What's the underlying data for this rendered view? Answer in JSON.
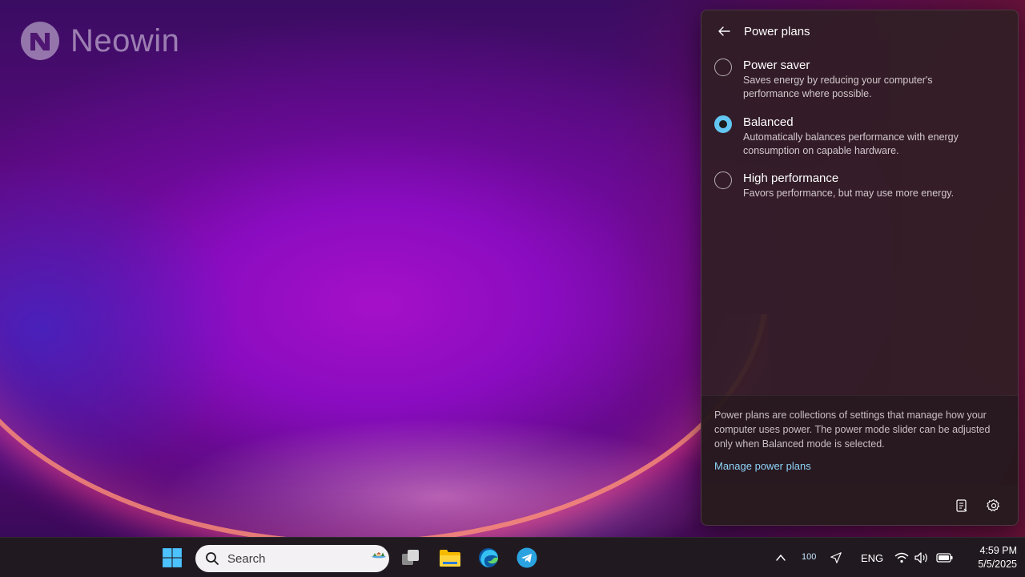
{
  "watermark": {
    "brand": "Neowin"
  },
  "flyout": {
    "title": "Power plans",
    "plans": [
      {
        "name": "Power saver",
        "desc_line1": "Saves energy by reducing your computer's",
        "desc_line2": "performance where possible.",
        "selected": false
      },
      {
        "name": "Balanced",
        "desc_line1": "Automatically balances performance with energy",
        "desc_line2": "consumption on capable hardware.",
        "selected": true
      },
      {
        "name": "High performance",
        "desc_line1": "Favors performance, but may use more energy.",
        "desc_line2": "",
        "selected": false
      }
    ],
    "info": "Power plans are collections of settings that manage how your computer uses power. The power mode slider can be adjusted only when Balanced mode is selected.",
    "manage_link": "Manage power plans",
    "icons": {
      "back": "back-arrow-icon",
      "battery_report": "document-icon",
      "settings": "gear-icon"
    }
  },
  "taskbar": {
    "search_label": "Search",
    "apps": [
      "start-icon",
      "task-view-icon",
      "file-explorer-icon",
      "edge-icon",
      "telegram-icon"
    ],
    "tray": {
      "battery_percent": "100",
      "language": "ENG",
      "time": "4:59 PM",
      "date": "5/5/2025"
    }
  },
  "colors": {
    "accent": "#63c6f2",
    "link": "#8dd4f8",
    "flyout_bg": "#301e24",
    "taskbar_bg": "#201a20"
  }
}
